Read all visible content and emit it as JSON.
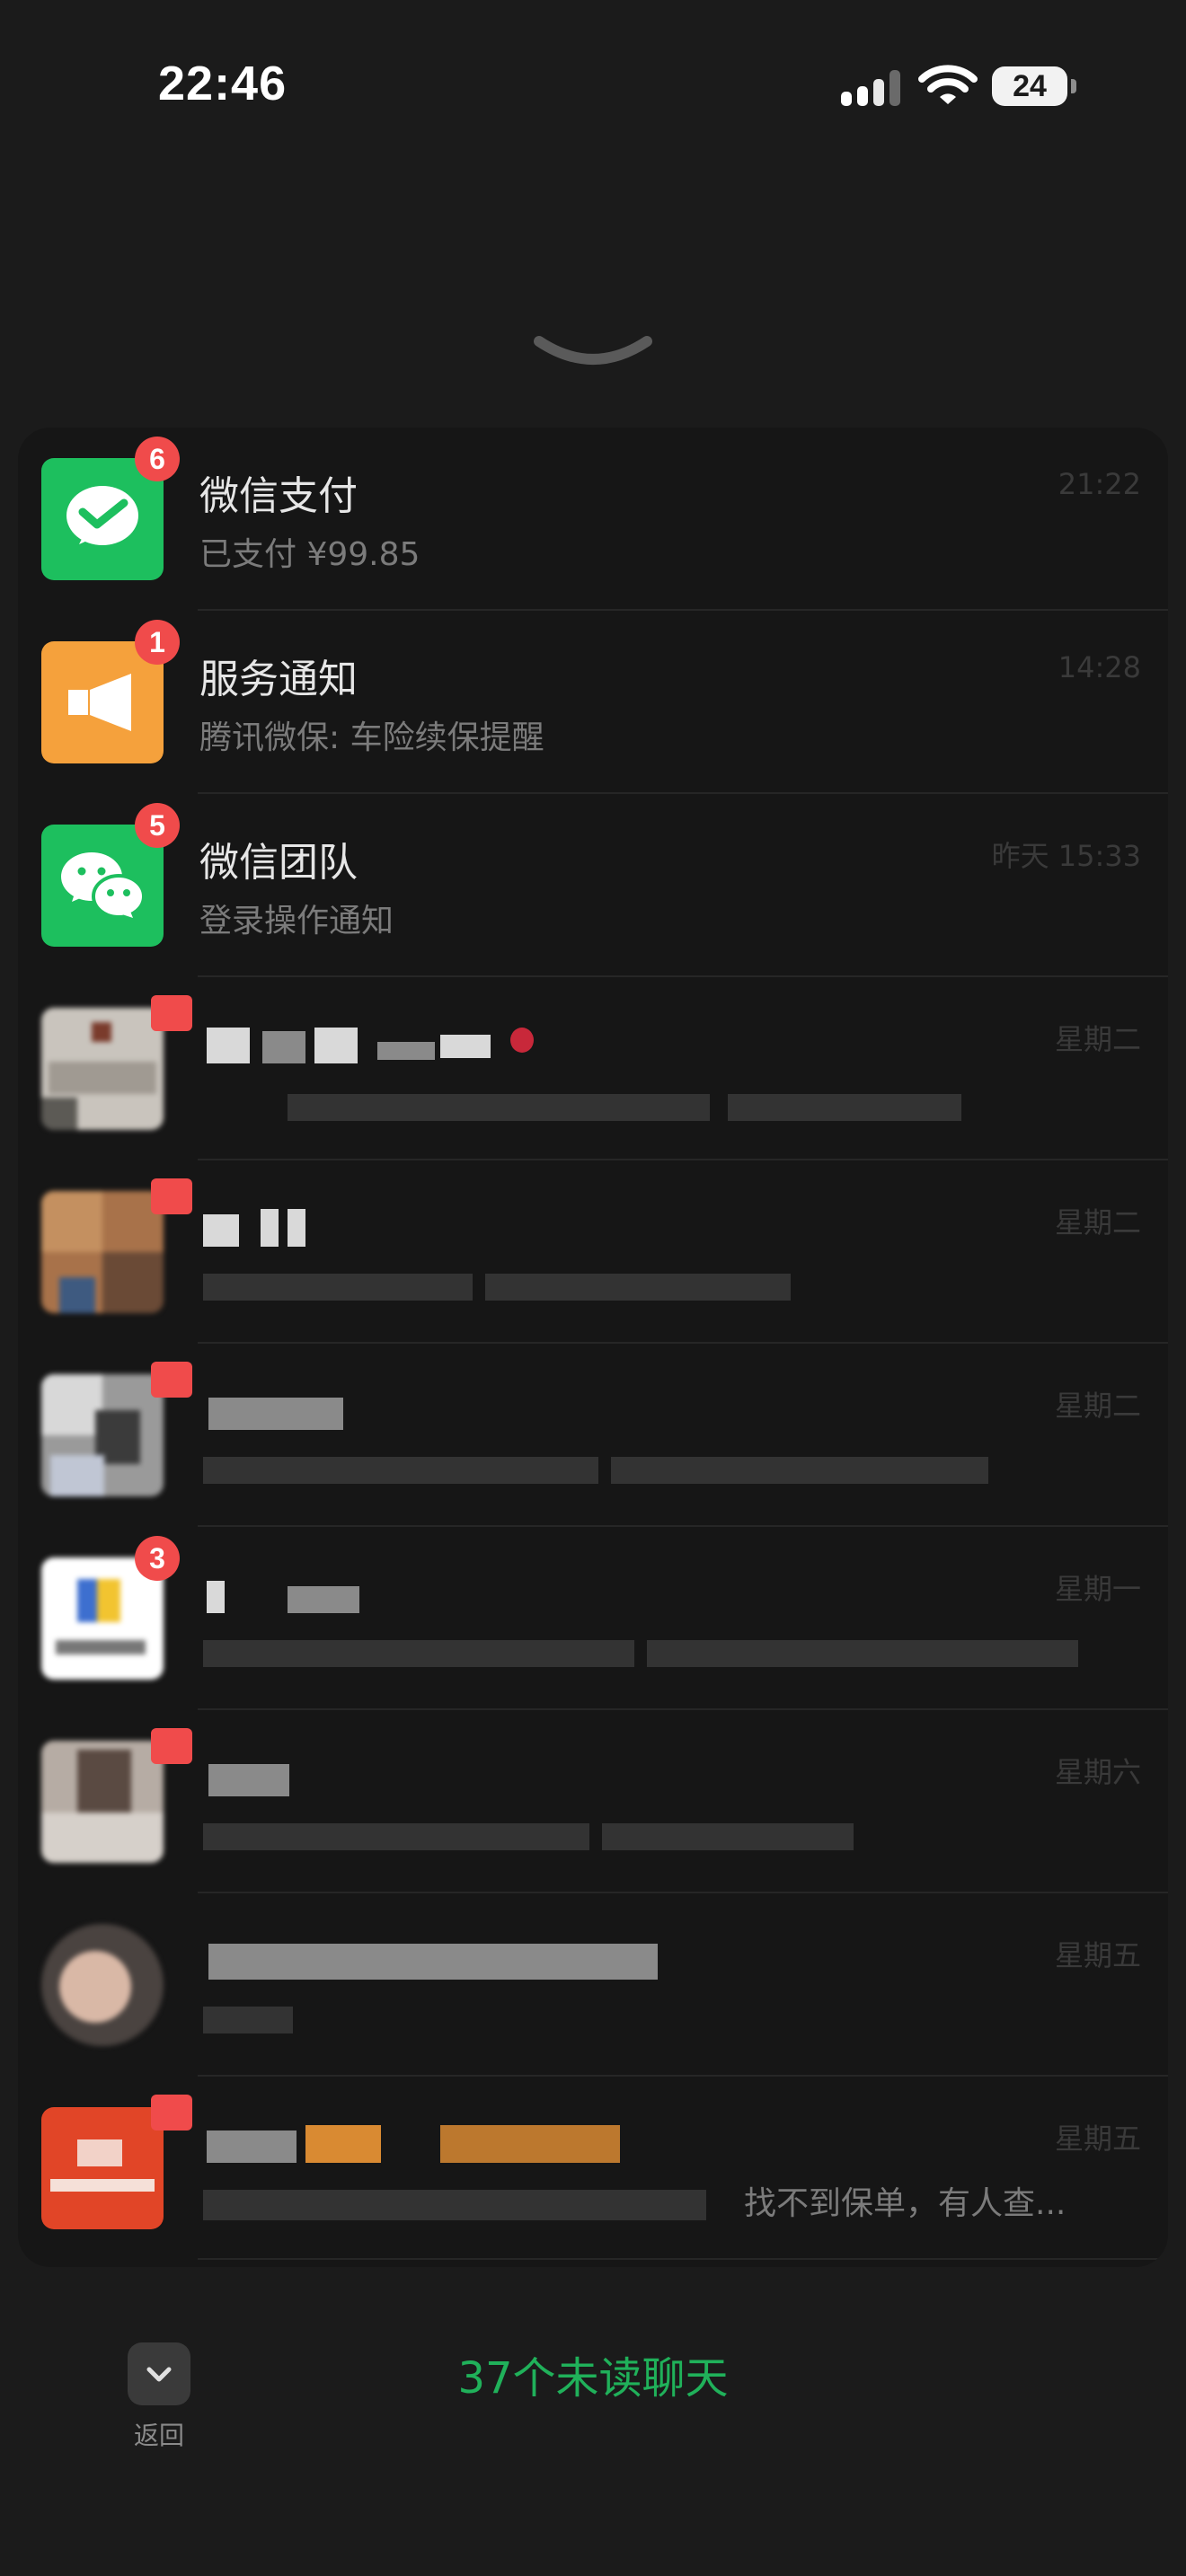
{
  "status_bar": {
    "time": "22:46",
    "battery": "24",
    "icons": [
      "cellular-signal-icon",
      "wifi-icon",
      "battery-icon"
    ]
  },
  "pull_down": {
    "icon": "chevron-down-icon"
  },
  "chats": [
    {
      "title": "微信支付",
      "subtitle": "已支付 ¥99.85",
      "time": "21:22",
      "badge": "6",
      "avatar": "wechat-pay-icon"
    },
    {
      "title": "服务通知",
      "subtitle": "腾讯微保: 车险续保提醒",
      "time": "14:28",
      "badge": "1",
      "avatar": "megaphone-icon"
    },
    {
      "title": "微信团队",
      "subtitle": "登录操作通知",
      "time": "昨天 15:33",
      "badge": "5",
      "avatar": "wechat-logo-icon"
    },
    {
      "title": "",
      "subtitle": "",
      "time": "星期二",
      "badge": "",
      "avatar": "blurred-avatar"
    },
    {
      "title": "",
      "subtitle": "",
      "time": "星期二",
      "badge": "",
      "avatar": "blurred-avatar"
    },
    {
      "title": "",
      "subtitle": "",
      "time": "星期二",
      "badge": "",
      "avatar": "blurred-avatar"
    },
    {
      "title": "",
      "subtitle": "",
      "time": "星期一",
      "badge": "3",
      "avatar": "blurred-avatar"
    },
    {
      "title": "",
      "subtitle": "",
      "time": "星期六",
      "badge": "",
      "avatar": "blurred-avatar"
    },
    {
      "title": "",
      "subtitle": "",
      "time": "星期五",
      "badge": "",
      "avatar": "blurred-avatar"
    },
    {
      "title": "",
      "subtitle": "找不到保单，有人查...",
      "time": "星期五",
      "badge": "",
      "avatar": "insurance-logo"
    }
  ],
  "bottom_bar": {
    "back_label": "返回",
    "unread_label": "37个未读聊天"
  },
  "colors": {
    "accent_green": "#20b15a",
    "badge_red": "#f04b4b",
    "wechat_green": "#1dbf5e",
    "service_orange": "#f5a13c"
  }
}
